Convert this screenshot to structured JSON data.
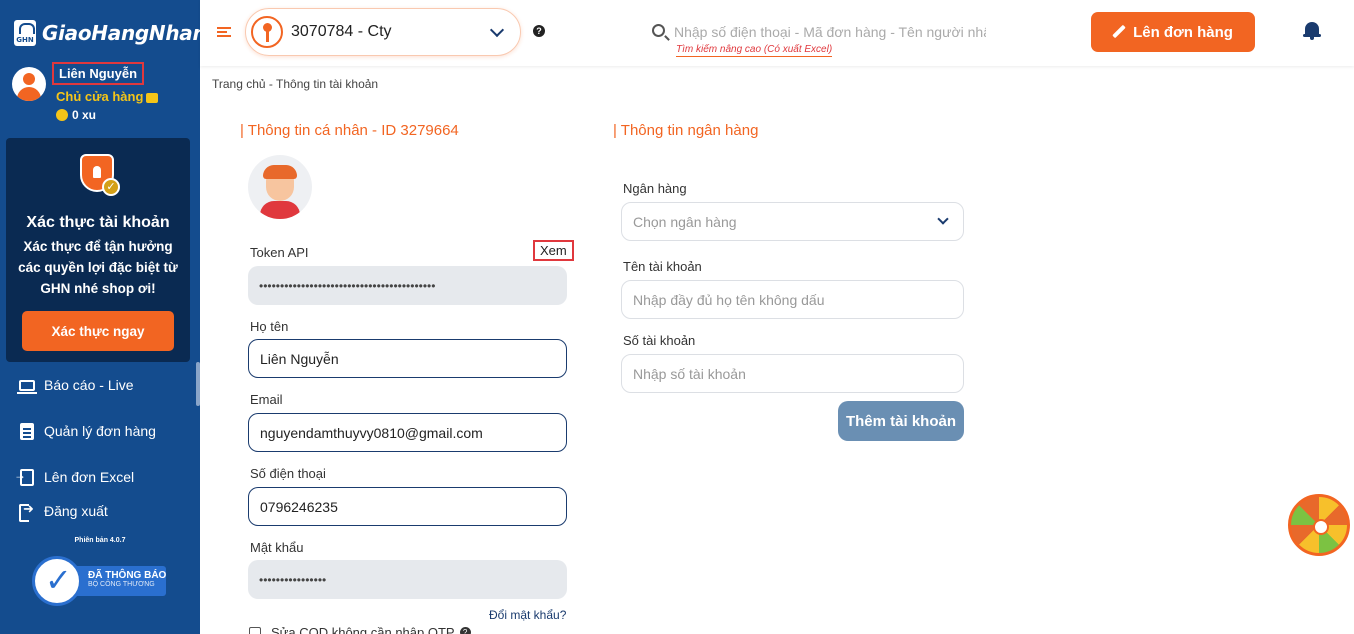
{
  "sidebar": {
    "logo_text": "GiaoHangNhanh",
    "logo_badge": "GHN",
    "user_name": "Liên Nguyễn",
    "user_role": "Chủ cửa hàng",
    "coins": "0 xu",
    "verify": {
      "title": "Xác thực tài khoản",
      "description": "Xác thực để tận hưởng các quyền lợi đặc biệt từ GHN nhé shop ơi!",
      "button": "Xác thực ngay"
    },
    "nav": [
      {
        "label": "Báo cáo - Live",
        "icon": "laptop-icon"
      },
      {
        "label": "Quản lý đơn hàng",
        "icon": "clipboard-icon"
      },
      {
        "label": "Lên đơn Excel",
        "icon": "file-import-icon"
      },
      {
        "label": "Đăng xuất",
        "icon": "logout-icon"
      }
    ],
    "version": "Phiên bản 4.0.7",
    "gov_badge_line1": "ĐÃ THÔNG BÁO",
    "gov_badge_line2": "BỘ CÔNG THƯƠNG"
  },
  "header": {
    "store": "3070784 - Cty",
    "search_placeholder": "Nhập số điện thoại - Mã đơn hàng - Tên người nhận",
    "advanced_search": "Tìm kiếm nâng cao (Có xuất Excel)",
    "create_order": "Lên đơn hàng"
  },
  "breadcrumb": "Trang chủ - Thông tin tài khoản",
  "profile": {
    "title": "| Thông tin cá nhân - ID 3279664",
    "token_label": "Token API",
    "token_view": "Xem",
    "token_value": "••••••••••••••••••••••••••••••••••••••••••",
    "name_label": "Họ tên",
    "name_value": "Liên Nguyễn",
    "email_label": "Email",
    "email_value": "nguyendamthuyvy0810@gmail.com",
    "phone_label": "Số điện thoại",
    "phone_value": "0796246235",
    "password_label": "Mật khẩu",
    "password_value": "••••••••••••••••",
    "change_password": "Đổi mật khẩu?",
    "cod_checkbox": "Sửa COD không cần nhập OTP"
  },
  "bank": {
    "title": "| Thông tin ngân hàng",
    "bank_label": "Ngân hàng",
    "bank_placeholder": "Chọn ngân hàng",
    "account_name_label": "Tên tài khoản",
    "account_name_placeholder": "Nhập đầy đủ họ tên không dấu",
    "account_number_label": "Số tài khoản",
    "account_number_placeholder": "Nhập số tài khoản",
    "add_button": "Thêm tài khoản"
  },
  "colors": {
    "brand_orange": "#f26522",
    "sidebar_blue": "#144c8e",
    "highlight_red": "#e0383d"
  }
}
